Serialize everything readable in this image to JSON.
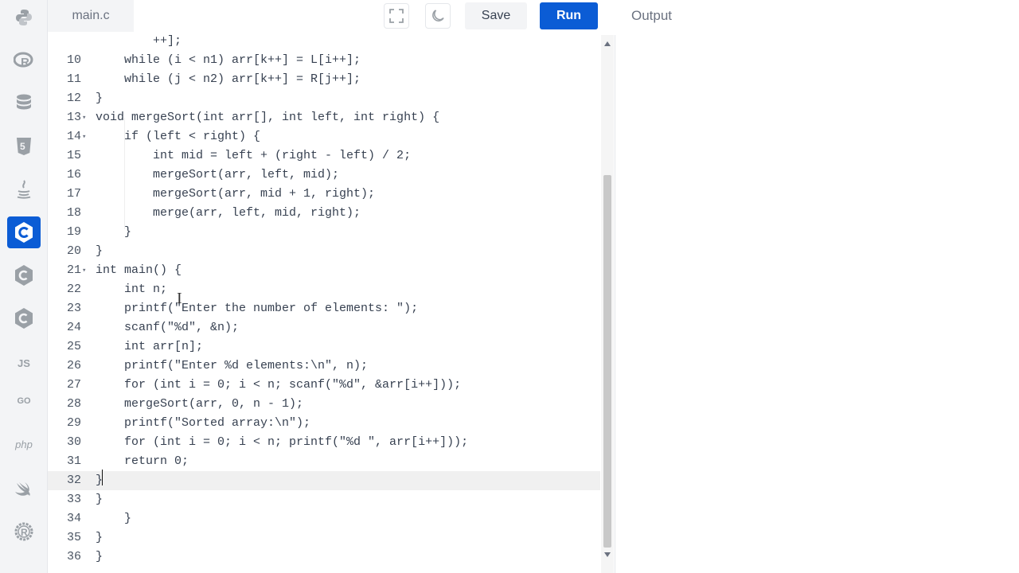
{
  "sidebar": {
    "languages": [
      {
        "icon": "python-icon",
        "label": ""
      },
      {
        "icon": "r-icon",
        "label": ""
      },
      {
        "icon": "database-icon",
        "label": ""
      },
      {
        "icon": "html5-icon",
        "label": ""
      },
      {
        "icon": "java-icon",
        "label": ""
      },
      {
        "icon": "c-icon",
        "label": "",
        "active": true
      },
      {
        "icon": "cpp-icon",
        "label": ""
      },
      {
        "icon": "csharp-icon",
        "label": ""
      },
      {
        "icon": "javascript-icon",
        "label": "JS"
      },
      {
        "icon": "go-icon",
        "label": "GO"
      },
      {
        "icon": "php-icon",
        "label": "php"
      },
      {
        "icon": "swift-icon",
        "label": ""
      },
      {
        "icon": "rust-icon",
        "label": ""
      }
    ],
    "accent": "#0b5cd5"
  },
  "toolbar": {
    "file_tab": "main.c",
    "save_label": "Save",
    "run_label": "Run",
    "fullscreen_icon": "fullscreen-icon",
    "theme_icon": "moon-icon"
  },
  "output": {
    "title": "Output"
  },
  "editor": {
    "current_line": "32",
    "lines": [
      {
        "num": "",
        "fold": "",
        "text": "        ++];"
      },
      {
        "num": "10",
        "fold": "",
        "text": "    while (i < n1) arr[k++] = L[i++];"
      },
      {
        "num": "11",
        "fold": "",
        "text": "    while (j < n2) arr[k++] = R[j++];"
      },
      {
        "num": "12",
        "fold": "",
        "text": "}"
      },
      {
        "num": "13",
        "fold": "▾",
        "text": "void mergeSort(int arr[], int left, int right) {"
      },
      {
        "num": "14",
        "fold": "▾",
        "text": "    if (left < right) {"
      },
      {
        "num": "15",
        "fold": "",
        "text": "        int mid = left + (right - left) / 2;"
      },
      {
        "num": "16",
        "fold": "",
        "text": "        mergeSort(arr, left, mid);"
      },
      {
        "num": "17",
        "fold": "",
        "text": "        mergeSort(arr, mid + 1, right);"
      },
      {
        "num": "18",
        "fold": "",
        "text": "        merge(arr, left, mid, right);"
      },
      {
        "num": "19",
        "fold": "",
        "text": "    }"
      },
      {
        "num": "20",
        "fold": "",
        "text": "}"
      },
      {
        "num": "21",
        "fold": "▾",
        "text": "int main() {"
      },
      {
        "num": "22",
        "fold": "",
        "text": "    int n;"
      },
      {
        "num": "23",
        "fold": "",
        "text": "    printf(\"Enter the number of elements: \");"
      },
      {
        "num": "24",
        "fold": "",
        "text": "    scanf(\"%d\", &n);"
      },
      {
        "num": "25",
        "fold": "",
        "text": "    int arr[n];"
      },
      {
        "num": "26",
        "fold": "",
        "text": "    printf(\"Enter %d elements:\\n\", n);"
      },
      {
        "num": "27",
        "fold": "",
        "text": "    for (int i = 0; i < n; scanf(\"%d\", &arr[i++]));"
      },
      {
        "num": "28",
        "fold": "",
        "text": "    mergeSort(arr, 0, n - 1);"
      },
      {
        "num": "29",
        "fold": "",
        "text": "    printf(\"Sorted array:\\n\");"
      },
      {
        "num": "30",
        "fold": "",
        "text": "    for (int i = 0; i < n; printf(\"%d \", arr[i++]));"
      },
      {
        "num": "31",
        "fold": "",
        "text": "    return 0;"
      },
      {
        "num": "32",
        "fold": "",
        "text": "}"
      },
      {
        "num": "33",
        "fold": "",
        "text": "}"
      },
      {
        "num": "34",
        "fold": "",
        "text": "    }"
      },
      {
        "num": "35",
        "fold": "",
        "text": "}"
      },
      {
        "num": "36",
        "fold": "",
        "text": "}"
      }
    ]
  }
}
